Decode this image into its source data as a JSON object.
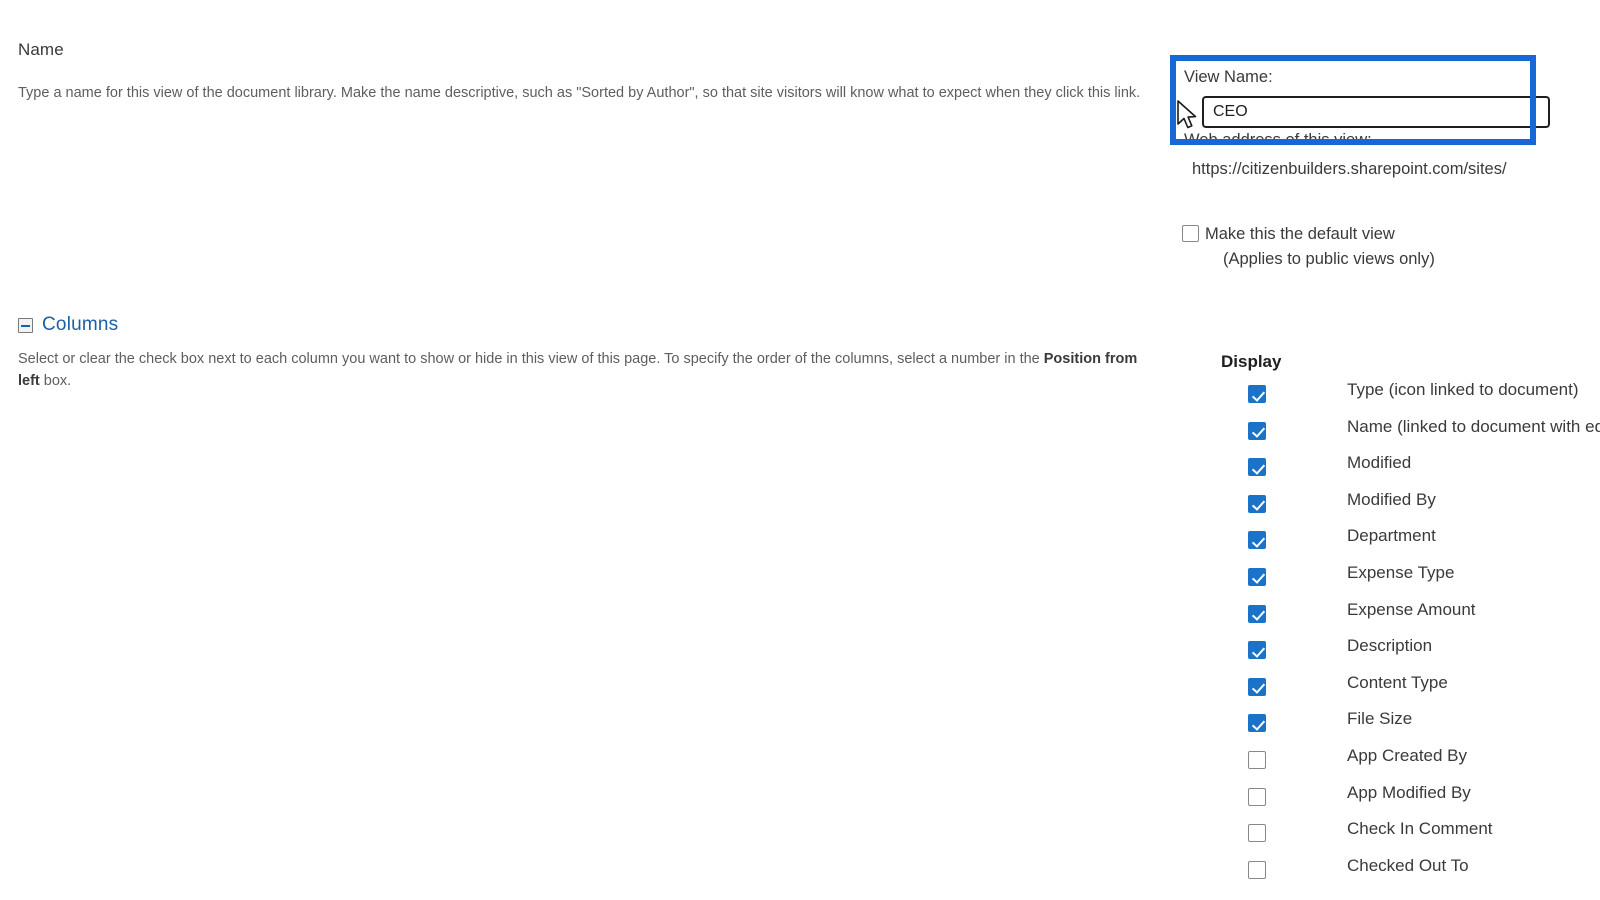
{
  "name_section": {
    "heading": "Name",
    "description": "Type a name for this view of the document library. Make the name descriptive, such as \"Sorted by Author\", so that site visitors will know what to expect when they click this link."
  },
  "view_name": {
    "label": "View Name:",
    "value": "CEO",
    "placeholder": ""
  },
  "web_address": {
    "label": "Web address of this view:",
    "value": "https://citizenbuilders.sharepoint.com/sites/"
  },
  "default_view": {
    "label": "Make this the default view",
    "sublabel": "(Applies to public views only)",
    "checked": false
  },
  "columns_section": {
    "heading": "Columns",
    "collapse_icon": "minus-square-icon",
    "description_part1": "Select or clear the check box next to each column you want to show or hide in this view of this page. To specify the order of the columns, select a number in the ",
    "description_bold": "Position from left",
    "description_part2": " box.",
    "display_header": "Display",
    "items": [
      {
        "label": "Type (icon linked to document)",
        "checked": true
      },
      {
        "label": "Name (linked to document with edit menu)",
        "checked": true
      },
      {
        "label": "Modified",
        "checked": true
      },
      {
        "label": "Modified By",
        "checked": true
      },
      {
        "label": "Department",
        "checked": true
      },
      {
        "label": "Expense Type",
        "checked": true
      },
      {
        "label": "Expense Amount",
        "checked": true
      },
      {
        "label": "Description",
        "checked": true
      },
      {
        "label": "Content Type",
        "checked": true
      },
      {
        "label": "File Size",
        "checked": true
      },
      {
        "label": "App Created By",
        "checked": false
      },
      {
        "label": "App Modified By",
        "checked": false
      },
      {
        "label": "Check In Comment",
        "checked": false
      },
      {
        "label": "Checked Out To",
        "checked": false
      }
    ]
  },
  "annotation": {
    "highlight_color": "#1668d6",
    "accent_color": "#1a73c8",
    "link_color": "#1b5fa8"
  },
  "cursor": {
    "type": "arrow-pointer"
  }
}
